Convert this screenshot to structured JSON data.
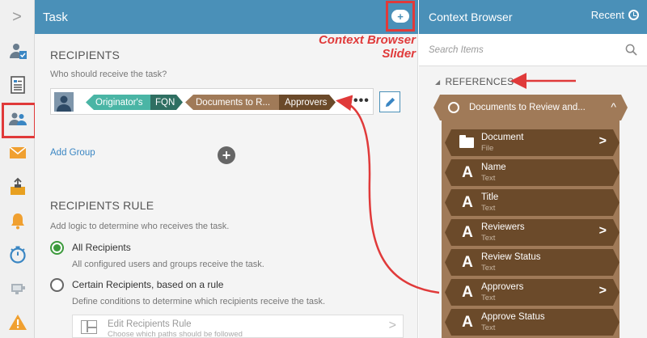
{
  "rail": {
    "expand_glyph": ">",
    "icons": [
      "user-check-icon",
      "document-list-icon",
      "users-icon",
      "envelope-icon",
      "inbox-upload-icon",
      "bell-icon",
      "stopwatch-icon",
      "screen-icon",
      "warning-icon"
    ],
    "active_index": 2
  },
  "task": {
    "title": "Task",
    "slider_glyph": "+",
    "recipients": {
      "title": "RECIPIENTS",
      "question": "Who should receive the task?",
      "chips": [
        {
          "left": "Originator's",
          "right": "FQN",
          "left_color": "#4ab5a5",
          "right_color": "#2f6f62"
        },
        {
          "left": "Documents to R...",
          "right": "Approvers",
          "left_color": "#a07a58",
          "right_color": "#6b4a2a"
        }
      ],
      "more_glyph": "•••",
      "add_group": "Add Group",
      "add_glyph": "+"
    },
    "rule": {
      "title": "RECIPIENTS RULE",
      "description": "Add logic to determine who receives the task.",
      "options": [
        {
          "label": "All Recipients",
          "desc": "All configured users and groups receive the task.",
          "selected": true
        },
        {
          "label": "Certain Recipients, based on a rule",
          "desc": "Define conditions to determine which recipients receive the task.",
          "selected": false
        }
      ],
      "edit_box": {
        "title": "Edit Recipients Rule",
        "subtitle": "Choose which paths should be followed",
        "chevron": ">"
      }
    }
  },
  "callout": {
    "line1": "Context Browser",
    "line2": "Slider",
    "color": "#e03a3a"
  },
  "context_browser": {
    "title": "Context Browser",
    "recent": "Recent",
    "search_placeholder": "Search Items",
    "section": "REFERENCES",
    "group": {
      "label": "Documents to Review and...",
      "caret": "^"
    },
    "items": [
      {
        "name": "Document",
        "type": "File",
        "icon": "folder-icon",
        "has_children": true
      },
      {
        "name": "Name",
        "type": "Text",
        "icon": "text-icon",
        "has_children": false
      },
      {
        "name": "Title",
        "type": "Text",
        "icon": "text-icon",
        "has_children": false
      },
      {
        "name": "Reviewers",
        "type": "Text",
        "icon": "text-icon",
        "has_children": true
      },
      {
        "name": "Review Status",
        "type": "Text",
        "icon": "text-icon",
        "has_children": false
      },
      {
        "name": "Approvers",
        "type": "Text",
        "icon": "text-icon",
        "has_children": true
      },
      {
        "name": "Approve Status",
        "type": "Text",
        "icon": "text-icon",
        "has_children": false
      }
    ],
    "text_glyph": "A",
    "item_chevron": ">"
  },
  "colors": {
    "header_blue": "#4a90b8",
    "annotation_red": "#e03a3a",
    "group_brown": "#a07a58",
    "item_brown": "#6b4a2a"
  }
}
